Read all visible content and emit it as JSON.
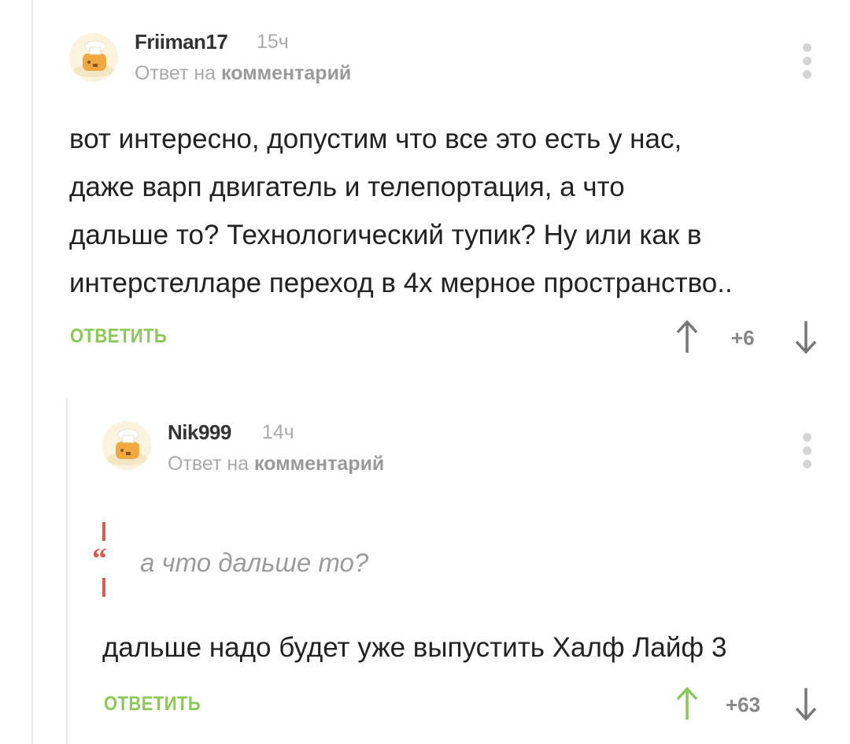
{
  "comments": [
    {
      "username": "Friiman17",
      "time": "15ч",
      "reply_prefix": "Ответ на",
      "reply_target": "комментарий",
      "lines": [
        "вот интересно, допустим что все это есть у нас,",
        "даже варп двигатель и телепортация, а что",
        "дальше то? Технологический тупик? Ну или как в",
        "интерстелларе переход в 4х мерное пространство.."
      ],
      "reply_label": "ОТВЕТИТЬ",
      "rating": "+6",
      "upvoted": false
    },
    {
      "username": "Nik999",
      "time": "14ч",
      "reply_prefix": "Ответ на",
      "reply_target": "комментарий",
      "quote": "а что дальше то?",
      "text": "дальше надо будет уже выпустить Халф Лайф 3",
      "reply_label": "ОТВЕТИТЬ",
      "rating": "+63",
      "upvoted": true
    }
  ],
  "colors": {
    "accent_green": "#8ac858",
    "quote_red": "#e0574f",
    "muted": "#aaaaaa"
  }
}
